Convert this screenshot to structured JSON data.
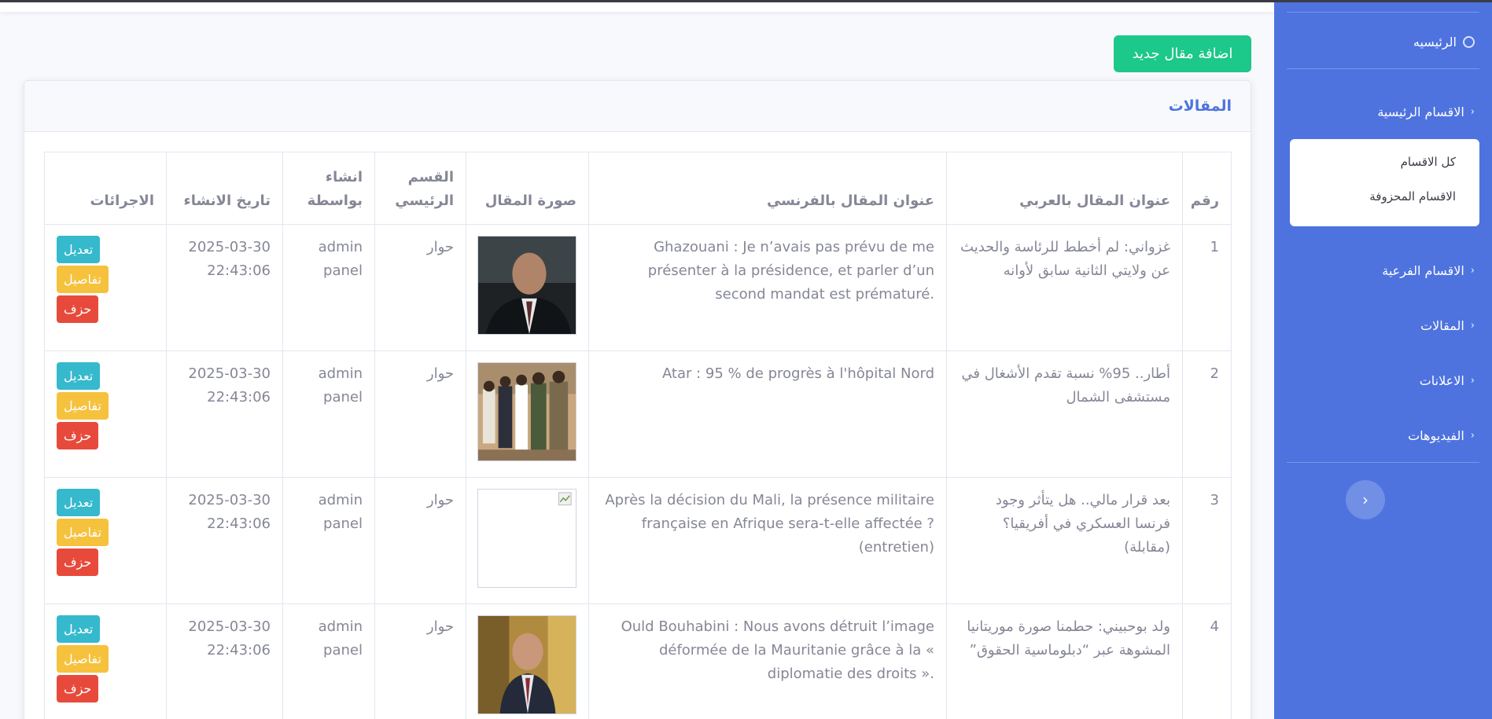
{
  "sidebar": {
    "home": "الرئيسيه",
    "main_sections": "الاقسام الرئيسية",
    "sub_items": [
      "كل الاقسام",
      "الاقسام المحزوفة"
    ],
    "sub_sections": "الاقسام الفرعية",
    "articles": "المقالات",
    "ads": "الاعلانات",
    "videos": "الفيديوهات",
    "toggle_glyph": "‹",
    "chevron_glyph": "‹"
  },
  "add_button": "اضافة مقال جديد",
  "card_title": "المقالات",
  "table": {
    "headers": [
      "رقم",
      "عنوان المقال بالعربي",
      "عنوان المقال بالفرنسي",
      "صورة المقال",
      "القسم الرئيسي",
      "انشاء بواسطة",
      "تاريخ الانشاء",
      "الاجرائات"
    ],
    "actions": {
      "edit": "تعديل",
      "details": "تفاصيل",
      "delete": "حزف"
    },
    "rows": [
      {
        "num": "1",
        "title_ar": "غزواني: لم أخطط للرئاسة والحديث عن ولايتي الثانية سابق لأوانه",
        "title_fr": "Ghazouani : Je n’avais pas prévu de me présenter à la présidence, et parler d’un second mandat est prématuré.",
        "image": "portrait-dark-suit",
        "section": "حوار",
        "created_by": "admin panel",
        "created_at": "2025-03-30 22:43:06"
      },
      {
        "num": "2",
        "title_ar": "أطار.. 95% نسبة تقدم الأشغال في مستشفى الشمال",
        "title_fr": "Atar : 95 % de progrès à l'hôpital Nord",
        "image": "group-visit",
        "section": "حوار",
        "created_by": "admin panel",
        "created_at": "2025-03-30 22:43:06"
      },
      {
        "num": "3",
        "title_ar": "بعد قرار مالي.. هل يتأثر وجود فرنسا العسكري في أفريقيا؟ (مقابلة)",
        "title_fr": "Après la décision du Mali, la présence militaire française en Afrique sera-t-elle affectée ? (entretien)",
        "image": "broken",
        "section": "حوار",
        "created_by": "admin panel",
        "created_at": "2025-03-30 22:43:06"
      },
      {
        "num": "4",
        "title_ar": "ولد بوحبيني: حطمنا صورة موريتانيا المشوهة عبر “دبلوماسية الحقوق”",
        "title_fr": "Ould Bouhabini : Nous avons détruit l’image déformée de la Mauritanie grâce à la « diplomatie des droits ».",
        "image": "portrait-suit",
        "section": "حوار",
        "created_by": "admin panel",
        "created_at": "2025-03-30 22:43:06"
      }
    ]
  },
  "colors": {
    "primary": "#4e73df",
    "success": "#1cc88a",
    "info": "#36b9cc",
    "warning": "#f6c23e",
    "danger": "#e74a3b"
  }
}
